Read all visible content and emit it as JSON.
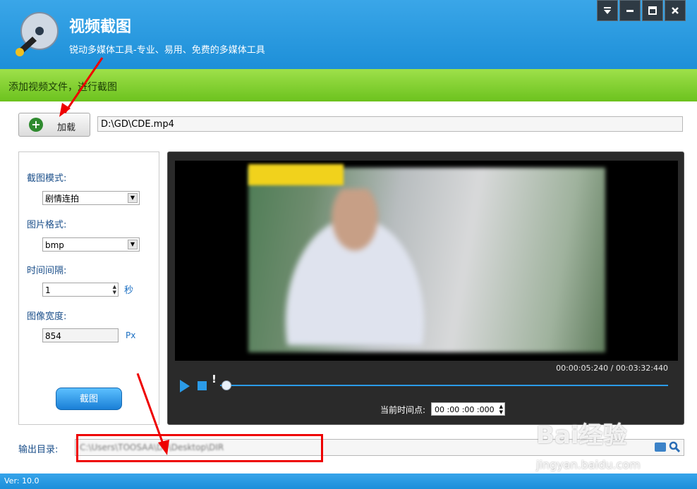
{
  "header": {
    "title": "视频截图",
    "subtitle": "锐动多媒体工具-专业、易用、免费的多媒体工具",
    "window_buttons": [
      "menu-icon",
      "minimize-icon",
      "maximize-icon",
      "close-icon"
    ]
  },
  "instruction_bar": {
    "text": "添加视频文件，进行截图"
  },
  "load": {
    "label": "加载",
    "file_path": "D:\\GD\\CDE.mp4"
  },
  "settings": {
    "mode_label": "截图模式:",
    "mode_value": "剧情连拍",
    "format_label": "图片格式:",
    "format_value": "bmp",
    "interval_label": "时间间隔:",
    "interval_value": "1",
    "interval_unit": "秒",
    "width_label": "图像宽度:",
    "width_value": "854",
    "width_unit": "Px",
    "capture_label": "截图"
  },
  "player": {
    "time_display": "00:00:05:240 / 00:03:32:440",
    "marker": "!",
    "current_time_label": "当前时间点:",
    "current_time_value": "00 :00 :00 :000",
    "progress": 0.01
  },
  "output": {
    "label": "输出目录:",
    "path": "C:\\Users\\TOOSAA\\DT\\Desktop\\DIR"
  },
  "footer": {
    "version": "Ver: 10.0"
  },
  "watermark": {
    "text": "Bai经验",
    "sub": "jingyan.baidu.com"
  },
  "colors": {
    "header": "#1d8fd8",
    "bar": "#6cc21e",
    "accent": "#2b9be8",
    "annotation": "#ee0000"
  }
}
